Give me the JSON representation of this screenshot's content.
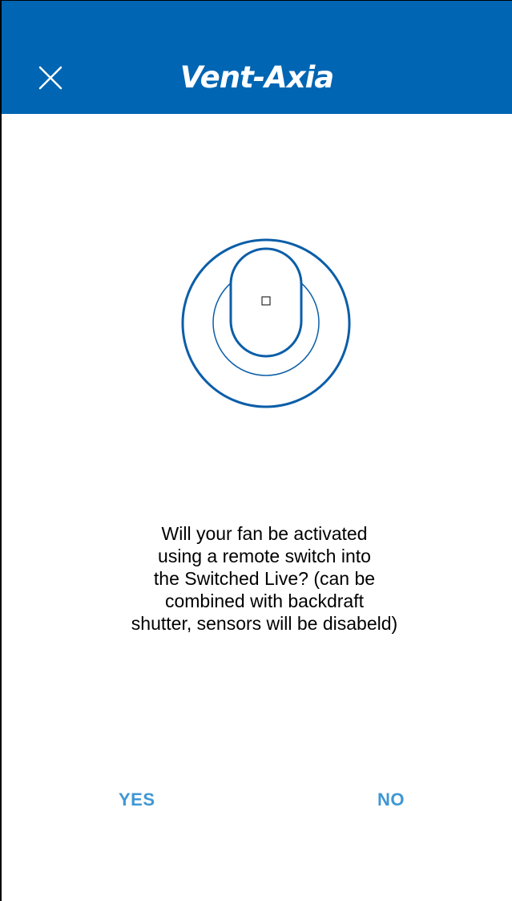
{
  "header": {
    "brand": "Vent-Axia",
    "close_icon": "close-icon",
    "background_color": "#0065b3"
  },
  "illustration": {
    "icon": "fan-device-icon",
    "color": "#0b5ea8"
  },
  "question": {
    "text": "Will your fan be activated\nusing a remote switch into\nthe Switched Live? (can be\ncombined with backdraft\nshutter, sensors will be disabeld)"
  },
  "actions": {
    "yes_label": "YES",
    "no_label": "NO",
    "accent_color": "#3f97d4"
  }
}
